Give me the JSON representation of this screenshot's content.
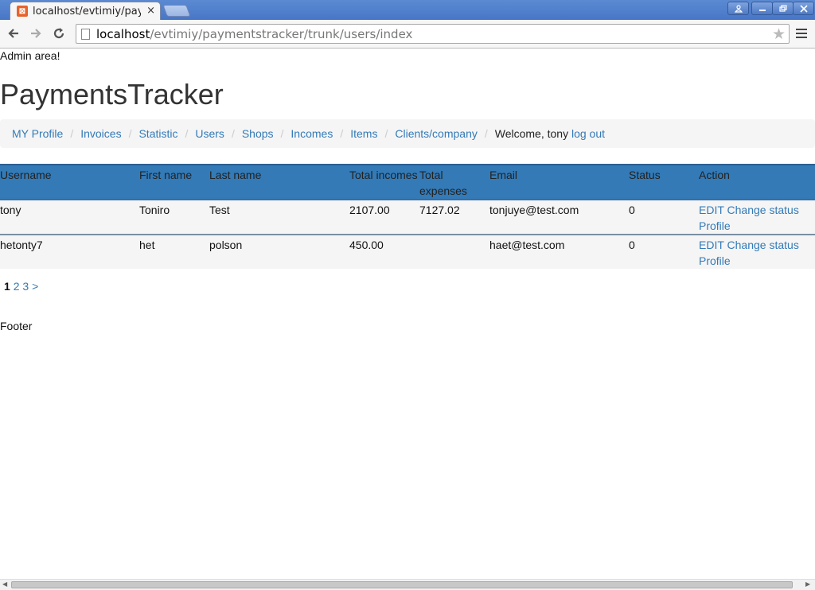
{
  "browser": {
    "tab_title": "localhost/evtimiy/paymentstracker/trunk/users/index",
    "tab_close": "×",
    "url_host": "localhost",
    "url_path": "/evtimiy/paymentstracker/trunk/users/index",
    "icons": {
      "back": "arrow-left-icon",
      "forward": "arrow-right-icon",
      "reload": "reload-icon",
      "star": "star-icon",
      "menu": "hamburger-menu-icon"
    }
  },
  "page": {
    "admin_area": "Admin area!",
    "brand": "PaymentsTracker",
    "nav": {
      "items": [
        "MY Profile",
        "Invoices",
        "Statistic",
        "Users",
        "Shops",
        "Incomes",
        "Items",
        "Clients/company"
      ],
      "separator": "/",
      "welcome": "Welcome, tony",
      "logout": "log out"
    },
    "table": {
      "headers": [
        "Username",
        "First name",
        "Last name",
        "Total incomes",
        "Total expenses",
        "Email",
        "Status",
        "Action"
      ],
      "rows": [
        {
          "username": "tony",
          "first_name": "Toniro",
          "last_name": "Test",
          "total_incomes": "2107.00",
          "total_expenses": "7127.02",
          "email": "tonjuye@test.com",
          "status": "0"
        },
        {
          "username": "hetonty7",
          "first_name": "het",
          "last_name": "polson",
          "total_incomes": "450.00",
          "total_expenses": "",
          "email": "haet@test.com",
          "status": "0"
        }
      ],
      "actions": {
        "edit": "EDIT",
        "change_status": "Change status",
        "profile": "Profile"
      }
    },
    "pagination": {
      "current": "1",
      "pages": [
        "2",
        "3"
      ],
      "next": ">"
    },
    "footer": "Footer"
  },
  "colors": {
    "header_bg": "#337ab7",
    "link": "#337ab7",
    "row_bg": "#f5f5f5"
  }
}
